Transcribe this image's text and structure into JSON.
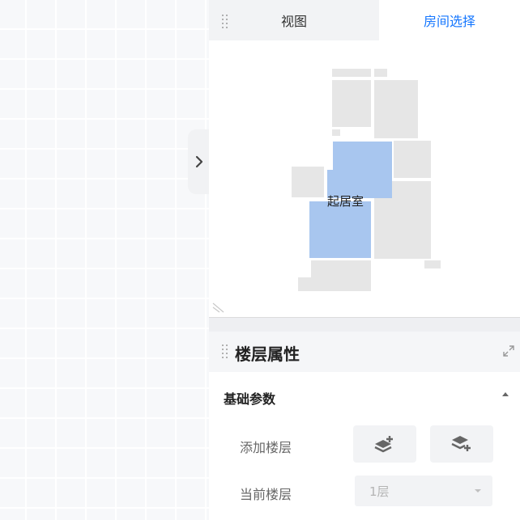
{
  "tabs": {
    "view_label": "视图",
    "room_select_label": "房间选择"
  },
  "floorplan": {
    "selected_room_label": "起居室"
  },
  "floor_properties": {
    "title": "楼层属性",
    "section_title": "基础参数",
    "add_floor_label": "添加楼层",
    "current_floor_label": "当前楼层",
    "current_floor_value": "1层"
  },
  "colors": {
    "accent": "#1677ff",
    "selected_room": "#a8c6ef",
    "room": "#e6e6e6"
  },
  "icons": [
    "chevron-right-icon",
    "drag-grip-icon",
    "resize-grip-icon",
    "expand-icon",
    "collapse-caret-icon",
    "add-floor-above-icon",
    "add-floor-below-icon",
    "dropdown-caret-icon"
  ]
}
